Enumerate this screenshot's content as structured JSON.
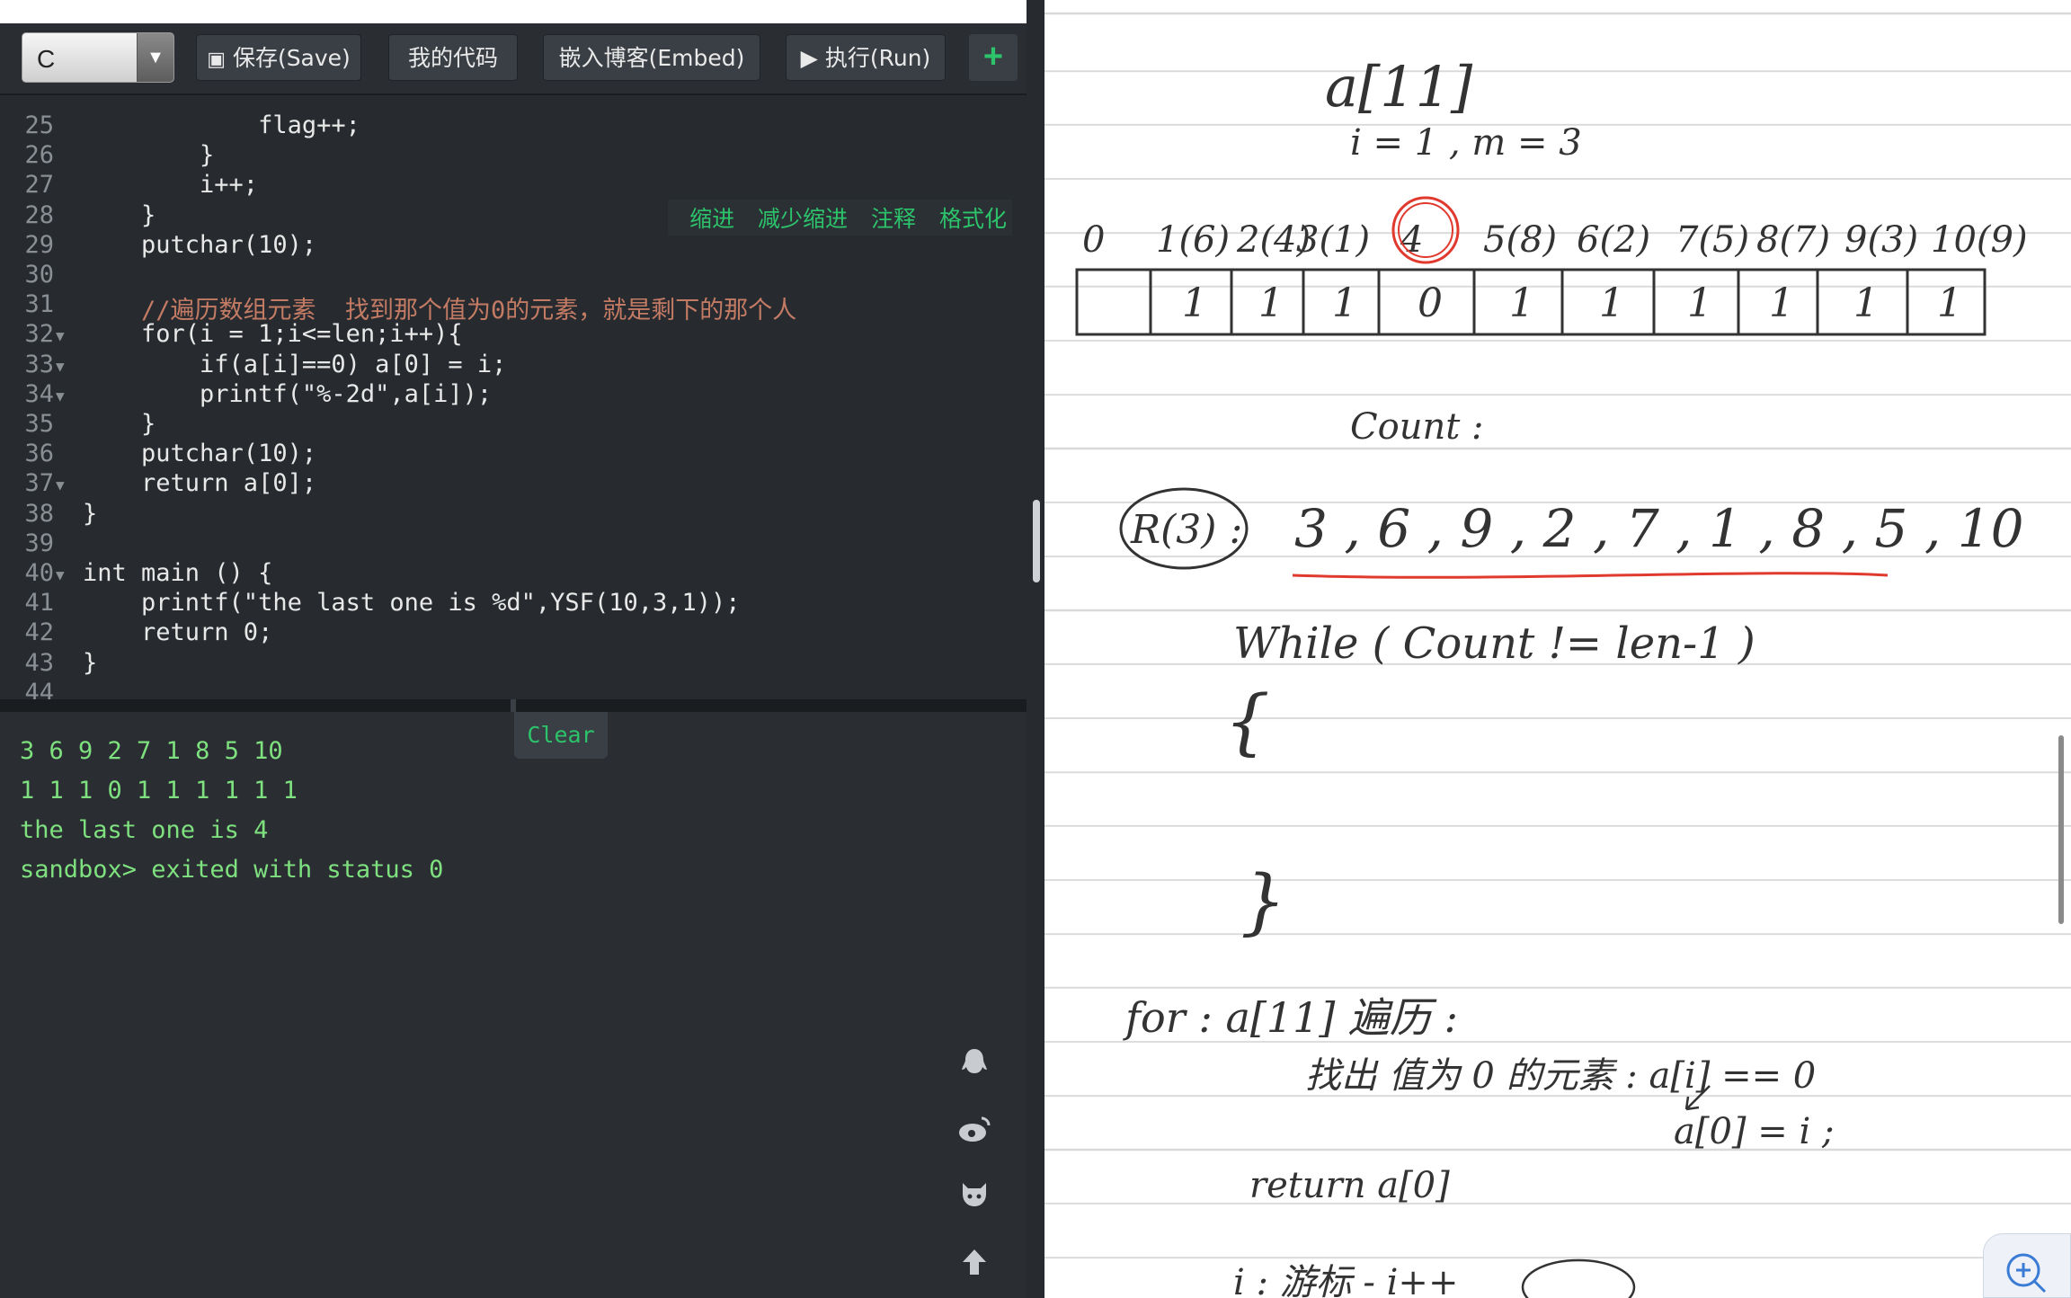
{
  "toolbar": {
    "language": "C",
    "save": "保存(Save)",
    "mycode": "我的代码",
    "embed": "嵌入博客(Embed)",
    "run": "执行(Run)",
    "add": "+"
  },
  "editor_tools": [
    "缩进",
    "减少缩进",
    "注释",
    "格式化"
  ],
  "code_lines": [
    {
      "n": "25",
      "text": "            flag++;"
    },
    {
      "n": "26",
      "text": "        }"
    },
    {
      "n": "27",
      "text": "        i++;"
    },
    {
      "n": "28",
      "text": "    }"
    },
    {
      "n": "29",
      "text": "    putchar(10);"
    },
    {
      "n": "30",
      "text": ""
    },
    {
      "n": "31",
      "text": "    //遍历数组元素  找到那个值为0的元素，就是剩下的那个人"
    },
    {
      "n": "32",
      "text": "    for(i = 1;i<=len;i++){"
    },
    {
      "n": "33",
      "text": "        if(a[i]==0) a[0] = i;"
    },
    {
      "n": "34",
      "text": "        printf(\"%-2d\",a[i]);"
    },
    {
      "n": "35",
      "text": "    }"
    },
    {
      "n": "36",
      "text": "    putchar(10);"
    },
    {
      "n": "37",
      "text": "    return a[0];"
    },
    {
      "n": "38",
      "text": "}"
    },
    {
      "n": "39",
      "text": ""
    },
    {
      "n": "40",
      "text": "int main () {"
    },
    {
      "n": "41",
      "text": "    printf(\"the last one is %d\",YSF(10,3,1));"
    },
    {
      "n": "42",
      "text": "    return 0;"
    },
    {
      "n": "43",
      "text": "}"
    },
    {
      "n": "44",
      "text": ""
    }
  ],
  "output": {
    "clear": "Clear",
    "lines": [
      "3 6 9 2 7 1 8 5 10",
      "1 1 1 0 1 1 1 1 1 1",
      "the last one is 4",
      "sandbox> exited with status 0"
    ]
  },
  "notes": {
    "top_label": "a[11]",
    "params": "i = 1 , m = 3",
    "indices": [
      "0",
      "1(6)",
      "2(4)",
      "3(1)",
      "4",
      "5(8)",
      "6(2)",
      "7(5)",
      "8(7)",
      "9(3)",
      "10(9)"
    ],
    "cells": [
      "",
      "1",
      "1",
      "1",
      "0",
      "1",
      "1",
      "1",
      "1",
      "1",
      "1"
    ],
    "count_label": "Count :",
    "result_label": "R(3) :",
    "result_seq": "3 , 6 , 9 , 2 , 7 , 1 , 8 , 5 , 10",
    "while_line": "While ( Count != len-1 )",
    "open_brace": "{",
    "close_brace": "}",
    "for_line": "for : a[11] 遍历 :",
    "find_line": "找出 值为 0 的元素 : a[i] == 0",
    "assign_line": "a[0] = i ;",
    "return_line": "return   a[0]",
    "bottom_line": "i : 游标  -  i++"
  },
  "colors": {
    "accent_green": "#2cc36b",
    "red_ink": "#e03a2f"
  }
}
